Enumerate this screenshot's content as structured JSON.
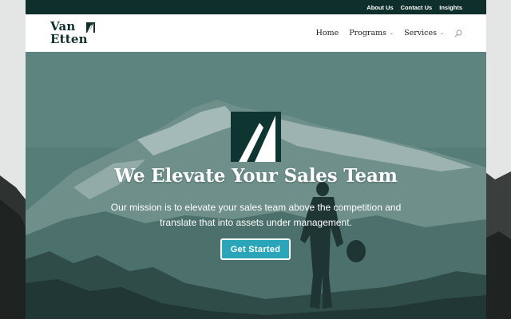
{
  "topbar": {
    "links": [
      "About Us",
      "Contact Us",
      "Insights"
    ]
  },
  "header": {
    "logo": {
      "line1": "Van",
      "line2": "Etten"
    },
    "nav": {
      "home": "Home",
      "programs": "Programs",
      "services": "Services"
    },
    "icons": {
      "dropdown": "chevron-down-icon",
      "search": "search-icon"
    }
  },
  "hero": {
    "title": "We Elevate Your Sales Team",
    "subtitle": "Our mission is to elevate your sales team above the competition and translate that into assets under management.",
    "cta_label": "Get Started"
  },
  "colors": {
    "brand_dark": "#0f2f2c",
    "hero_overlay": "#4f7772",
    "cta": "#2aa5b9"
  }
}
